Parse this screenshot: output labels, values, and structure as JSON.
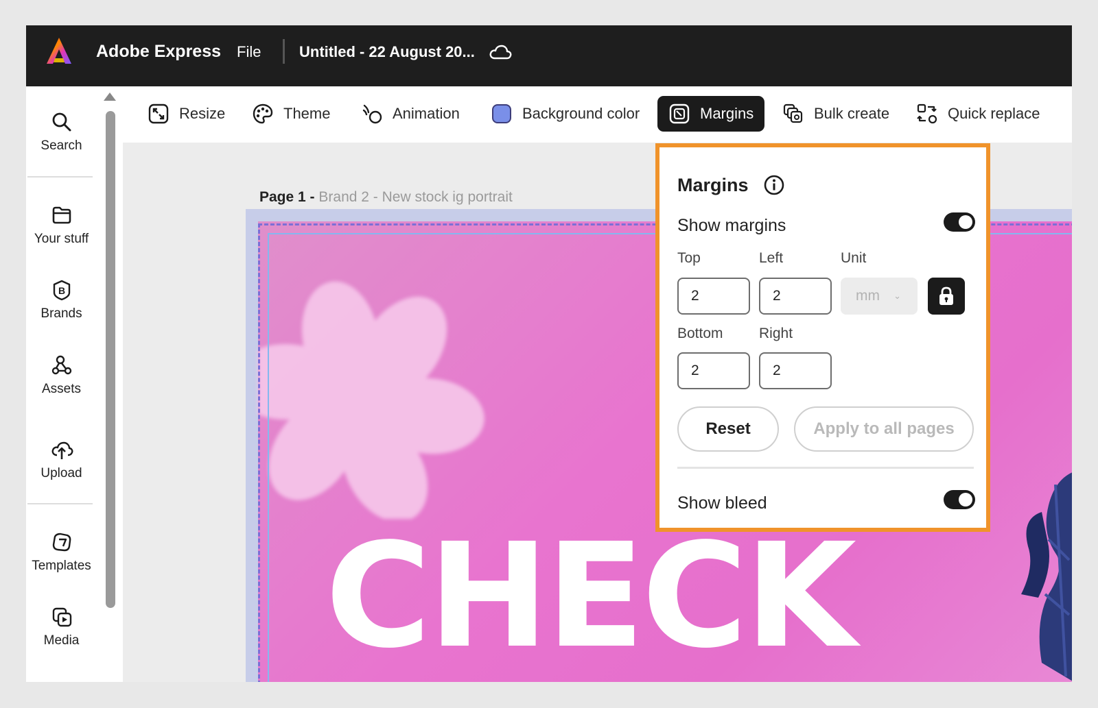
{
  "header": {
    "app_name": "Adobe Express",
    "file_menu": "File",
    "document_title": "Untitled - 22 August 20..."
  },
  "rail": {
    "items": [
      {
        "label": "Search",
        "icon": "search-icon"
      },
      {
        "label": "Your stuff",
        "icon": "folder-icon"
      },
      {
        "label": "Brands",
        "icon": "brand-icon"
      },
      {
        "label": "Assets",
        "icon": "assets-icon"
      },
      {
        "label": "Upload",
        "icon": "cloud-upload-icon"
      },
      {
        "label": "Templates",
        "icon": "templates-icon"
      },
      {
        "label": "Media",
        "icon": "media-icon"
      }
    ]
  },
  "toolbar": {
    "resize": "Resize",
    "theme": "Theme",
    "animation": "Animation",
    "background_color": "Background color",
    "background_swatch": "#7a8fe8",
    "margins": "Margins",
    "bulk_create": "Bulk create",
    "quick_replace": "Quick replace"
  },
  "canvas": {
    "page_prefix": "Page 1 -",
    "page_name": "Brand 2 - New stock ig portrait",
    "headline": "CHECK"
  },
  "margins_panel": {
    "title": "Margins",
    "show_margins_label": "Show margins",
    "show_margins_on": true,
    "top_label": "Top",
    "left_label": "Left",
    "unit_label": "Unit",
    "bottom_label": "Bottom",
    "right_label": "Right",
    "top_value": "2",
    "left_value": "2",
    "bottom_value": "2",
    "right_value": "2",
    "unit_value": "mm",
    "reset_label": "Reset",
    "apply_label": "Apply to all pages",
    "show_bleed_label": "Show bleed",
    "show_bleed_on": true,
    "highlight_color": "#f0932b"
  }
}
